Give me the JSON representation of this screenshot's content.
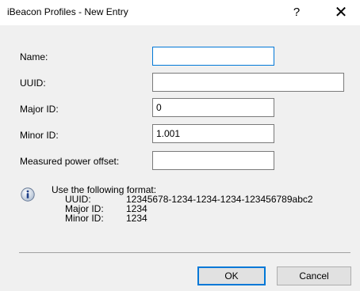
{
  "window": {
    "title": "iBeacon Profiles - New Entry",
    "help_glyph": "?",
    "close_glyph": "✕"
  },
  "form": {
    "name": {
      "label": "Name:",
      "value": ""
    },
    "uuid": {
      "label": "UUID:",
      "value": ""
    },
    "major_id": {
      "label": "Major ID:",
      "value": "0"
    },
    "minor_id": {
      "label": "Minor ID:",
      "value": "1.001"
    },
    "power_offset": {
      "label": "Measured power offset:",
      "value": ""
    }
  },
  "info": {
    "icon": "info-icon",
    "heading": "Use the following format:",
    "rows": [
      {
        "label": "UUID:",
        "value": "12345678-1234-1234-1234-123456789abc2"
      },
      {
        "label": "Major ID:",
        "value": "1234"
      },
      {
        "label": "Minor ID:",
        "value": "1234"
      }
    ]
  },
  "buttons": {
    "ok": "OK",
    "cancel": "Cancel"
  },
  "colors": {
    "accent": "#0078d7",
    "background": "#f0f0f0"
  }
}
